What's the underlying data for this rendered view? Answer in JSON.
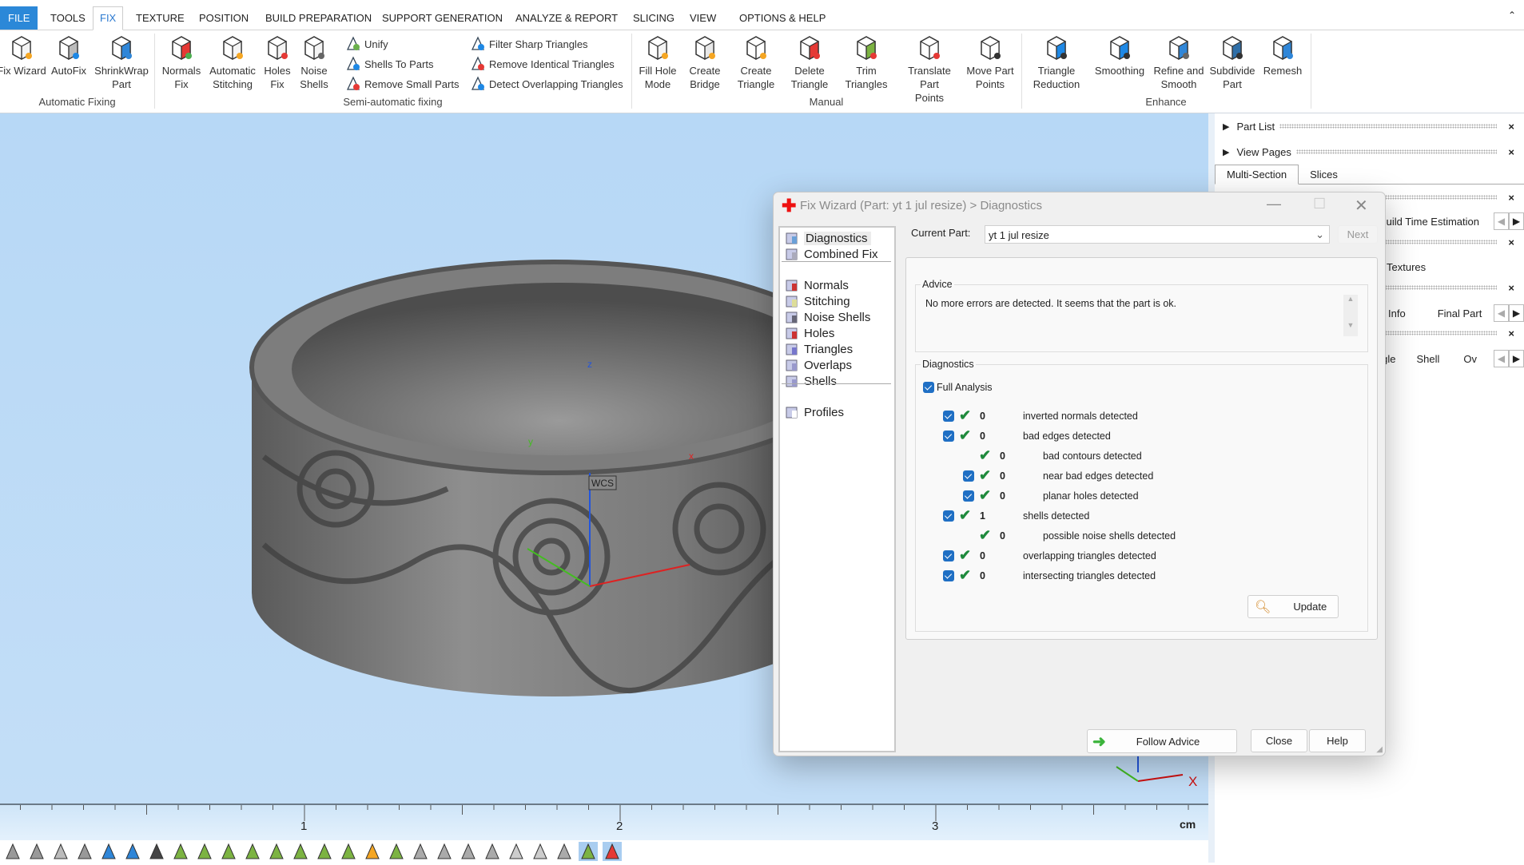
{
  "menu": {
    "tabs": [
      "FILE",
      "TOOLS",
      "FIX",
      "TEXTURE",
      "POSITION",
      "BUILD PREPARATION",
      "SUPPORT GENERATION",
      "ANALYZE & REPORT",
      "SLICING",
      "VIEW",
      "OPTIONS & HELP"
    ],
    "selected": "FIX",
    "collapse_icon": "chevron-up-icon"
  },
  "ribbon": {
    "groups": [
      "Automatic Fixing",
      "Semi-automatic fixing",
      "Manual",
      "Enhance"
    ],
    "buttons": [
      {
        "l1": "Fix Wizard",
        "l2": "",
        "icon": "fix-wizard-icon"
      },
      {
        "l1": "AutoFix",
        "l2": "",
        "icon": "autofix-icon"
      },
      {
        "l1": "ShrinkWrap",
        "l2": "Part",
        "icon": "shrinkwrap-icon"
      },
      {
        "l1": "Normals",
        "l2": "Fix",
        "icon": "normals-fix-icon"
      },
      {
        "l1": "Automatic",
        "l2": "Stitching",
        "icon": "stitching-icon"
      },
      {
        "l1": "Holes",
        "l2": "Fix",
        "icon": "holes-fix-icon"
      },
      {
        "l1": "Noise",
        "l2": "Shells",
        "icon": "noise-shells-icon"
      },
      {
        "l1": "Fill Hole",
        "l2": "Mode",
        "icon": "fill-hole-icon"
      },
      {
        "l1": "Create",
        "l2": "Bridge",
        "icon": "create-bridge-icon"
      },
      {
        "l1": "Create",
        "l2": "Triangle",
        "icon": "create-triangle-icon"
      },
      {
        "l1": "Delete",
        "l2": "Triangle",
        "icon": "delete-triangle-icon"
      },
      {
        "l1": "Trim",
        "l2": "Triangles",
        "icon": "trim-triangles-icon"
      },
      {
        "l1": "Translate Part",
        "l2": "Points",
        "icon": "translate-points-icon"
      },
      {
        "l1": "Move Part",
        "l2": "Points",
        "icon": "move-points-icon"
      },
      {
        "l1": "Triangle",
        "l2": "Reduction",
        "icon": "triangle-reduction-icon"
      },
      {
        "l1": "Smoothing",
        "l2": "",
        "icon": "smoothing-icon"
      },
      {
        "l1": "Refine and",
        "l2": "Smooth",
        "icon": "refine-smooth-icon"
      },
      {
        "l1": "Subdivide",
        "l2": "Part",
        "icon": "subdivide-icon"
      },
      {
        "l1": "Remesh",
        "l2": "",
        "icon": "remesh-icon"
      }
    ],
    "small": [
      "Unify",
      "Shells To Parts",
      "Remove Small Parts",
      "Filter Sharp Triangles",
      "Remove Identical Triangles",
      "Detect Overlapping Triangles"
    ]
  },
  "viewport": {
    "axis_x": "x",
    "axis_y": "y",
    "axis_z": "z",
    "wcs": "WCS",
    "mini_x": "X",
    "ruler_labels": [
      "1",
      "2",
      "3"
    ],
    "unit": "cm",
    "bg": "#b9d9f6"
  },
  "right_panel": {
    "part_list": "Part List",
    "view_pages": "View Pages",
    "tabs": [
      "Multi-Section",
      "Slices"
    ],
    "build_time": "Build Time Estimation",
    "textures": "Textures",
    "info": "Info",
    "final_part": "Final Part",
    "triangle": "Triangle",
    "shell": "Shell",
    "ov": "Ov",
    "close": "×"
  },
  "dialog": {
    "title": "Fix Wizard (Part: yt 1 jul resize) > Diagnostics",
    "nav": [
      {
        "label": "Diagnostics",
        "icon": "magnifier-icon"
      },
      {
        "label": "Combined Fix",
        "icon": "combined-fix-icon"
      },
      {
        "label": "Normals",
        "icon": "normals-icon"
      },
      {
        "label": "Stitching",
        "icon": "stitching-icon"
      },
      {
        "label": "Noise Shells",
        "icon": "noise-shells-icon"
      },
      {
        "label": "Holes",
        "icon": "holes-icon"
      },
      {
        "label": "Triangles",
        "icon": "triangles-icon"
      },
      {
        "label": "Overlaps",
        "icon": "overlaps-icon"
      },
      {
        "label": "Shells",
        "icon": "shells-icon"
      },
      {
        "label": "Profiles",
        "icon": "profiles-icon"
      }
    ],
    "current_part_label": "Current Part:",
    "current_part": "yt 1 jul resize",
    "next": "Next",
    "advice_label": "Advice",
    "advice_text": "No more errors are detected. It seems that the part is ok.",
    "diagnostics_label": "Diagnostics",
    "full_analysis": "Full Analysis",
    "rows": [
      {
        "count": "0",
        "label": "inverted normals detected",
        "checkbox": true,
        "sub": false
      },
      {
        "count": "0",
        "label": "bad edges detected",
        "checkbox": true,
        "sub": false
      },
      {
        "count": "0",
        "label": "bad contours detected",
        "checkbox": false,
        "sub": true
      },
      {
        "count": "0",
        "label": "near bad edges detected",
        "checkbox": true,
        "sub": true
      },
      {
        "count": "0",
        "label": "planar holes detected",
        "checkbox": true,
        "sub": true
      },
      {
        "count": "1",
        "label": "shells detected",
        "checkbox": true,
        "sub": false
      },
      {
        "count": "0",
        "label": "possible noise shells detected",
        "checkbox": false,
        "sub": true
      },
      {
        "count": "0",
        "label": "overlapping triangles detected",
        "checkbox": true,
        "sub": false
      },
      {
        "count": "0",
        "label": "intersecting triangles detected",
        "checkbox": true,
        "sub": false
      }
    ],
    "update": "Update",
    "follow_advice": "Follow Advice",
    "close": "Close",
    "help": "Help",
    "accent": "#1f6fc4",
    "ok_color": "#1f8a3c"
  },
  "bottom_toolbar": {
    "icons": [
      "zoom-icon",
      "zoom-box-icon",
      "zoom-part-icon",
      "zoom-selection-icon",
      "view-cube-icon",
      "view-front-icon",
      "shaded-icon",
      "select-triangle-icon",
      "select-plane-icon",
      "select-surface-icon",
      "select-shell-icon",
      "select-box-icon",
      "select-lasso-icon",
      "select-curve-icon",
      "select-wave-icon",
      "select-part-icon",
      "expand-selection-icon",
      "shrink-selection-icon",
      "delete-selection-icon",
      "invert-selection-icon",
      "grow-icon",
      "unselect-icon",
      "unselect-all-icon",
      "select-info-icon",
      "mark-triangles-icon",
      "mark-color-icon"
    ]
  }
}
